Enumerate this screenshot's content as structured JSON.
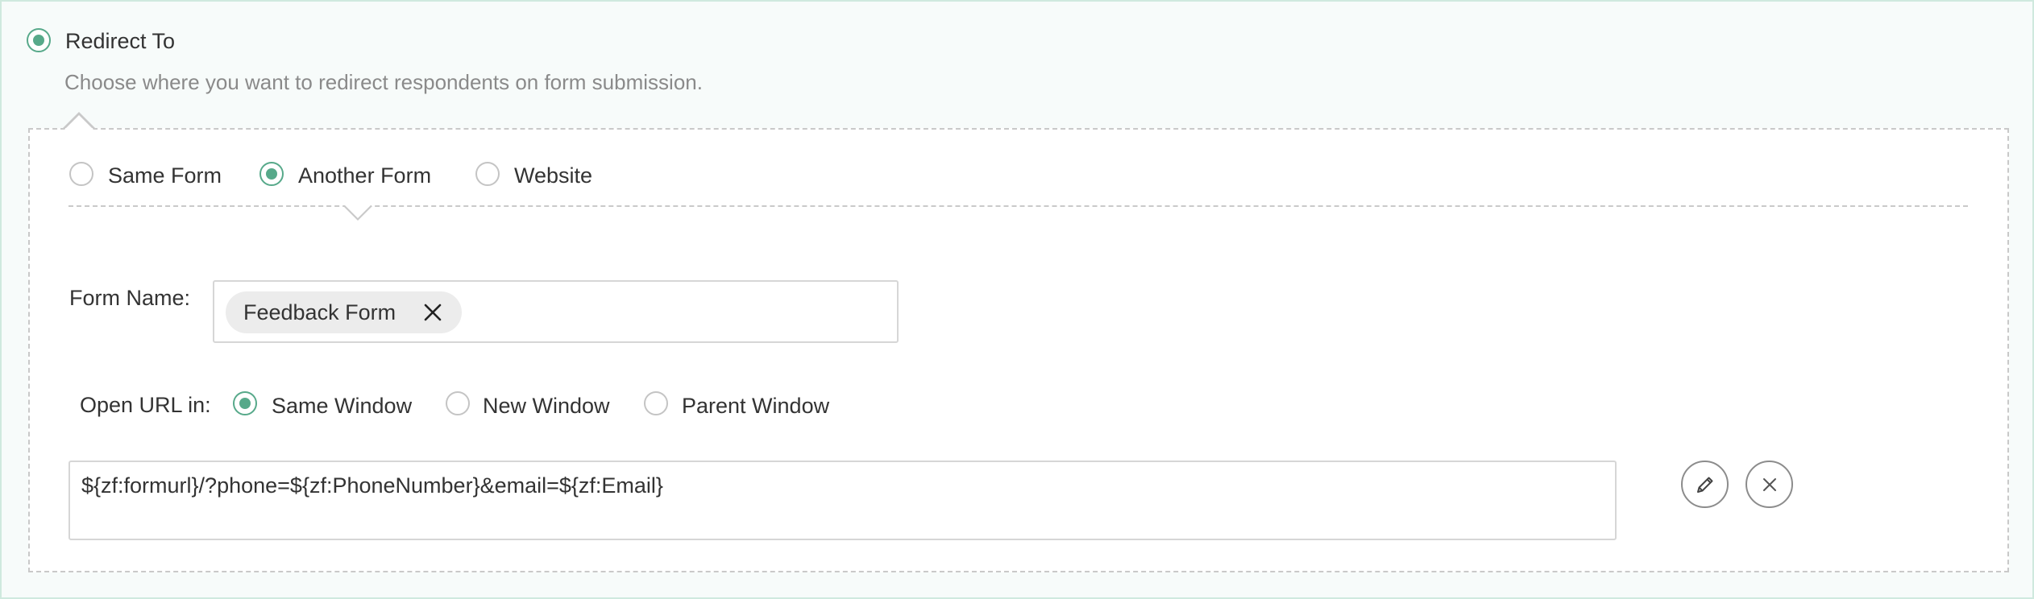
{
  "redirect": {
    "title": "Redirect To",
    "description": "Choose where you want to redirect respondents on form submission.",
    "checked": true
  },
  "target_options": [
    {
      "label": "Same Form",
      "selected": false
    },
    {
      "label": "Another Form",
      "selected": true
    },
    {
      "label": "Website",
      "selected": false
    }
  ],
  "form_name": {
    "label": "Form Name:",
    "selected_value": "Feedback Form",
    "remove_icon": "close-icon"
  },
  "open_url": {
    "label": "Open URL in:",
    "options": [
      {
        "label": "Same Window",
        "selected": true
      },
      {
        "label": "New Window",
        "selected": false
      },
      {
        "label": "Parent Window",
        "selected": false
      }
    ]
  },
  "url_value": "${zf:formurl}/?phone=${zf:PhoneNumber}&email=${zf:Email}",
  "actions": {
    "edit_icon": "pencil-icon",
    "clear_icon": "close-icon"
  },
  "colors": {
    "accent": "#57a98a",
    "frame_border": "#cfe9de",
    "frame_background": "#f7fbfa"
  }
}
